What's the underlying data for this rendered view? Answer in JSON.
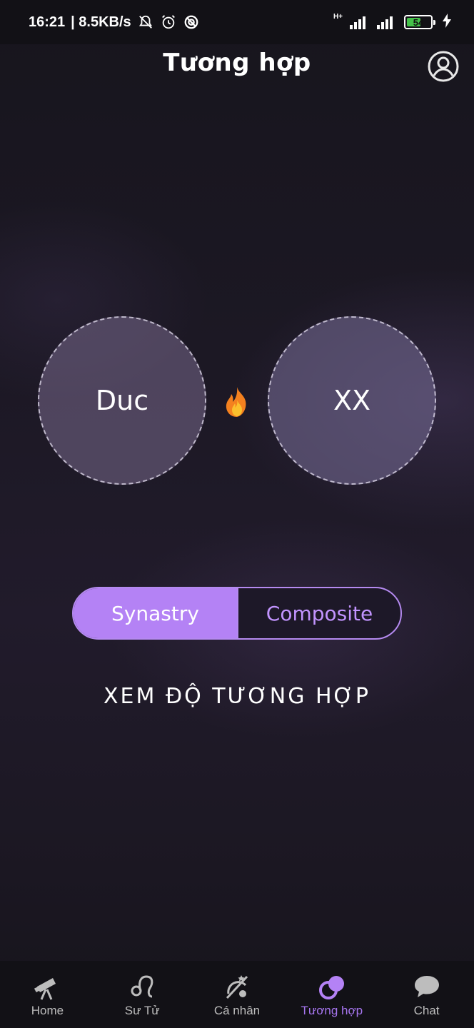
{
  "status_bar": {
    "time": "16:21",
    "network_speed": "| 8.5KB/s",
    "battery_level": "54",
    "icons": [
      "mute-icon",
      "alarm-icon",
      "sync-icon",
      "signal-icon",
      "battery-icon",
      "charging-icon"
    ]
  },
  "header": {
    "title": "Tương hợp",
    "profile_icon": "account-circle-icon"
  },
  "pair": {
    "person1": "Duc",
    "person2": "XX",
    "connector_icon": "fire-icon"
  },
  "mode_toggle": {
    "options": [
      "Synastry",
      "Composite"
    ],
    "selected": "Synastry"
  },
  "action": {
    "label": "XEM ĐỘ TƯƠNG HỢP"
  },
  "bottom_nav": {
    "items": [
      {
        "label": "Home",
        "icon": "telescope-icon"
      },
      {
        "label": "Sư Tử",
        "icon": "leo-icon"
      },
      {
        "label": "Cá nhân",
        "icon": "personal-chart-icon"
      },
      {
        "label": "Tương hợp",
        "icon": "compatibility-icon"
      },
      {
        "label": "Chat",
        "icon": "chat-bubble-icon"
      }
    ],
    "active": "Tương hợp"
  },
  "colors": {
    "accent": "#b482f5",
    "accent_text": "#c294ff",
    "background": "#1c1824",
    "bar_background": "#121116"
  }
}
